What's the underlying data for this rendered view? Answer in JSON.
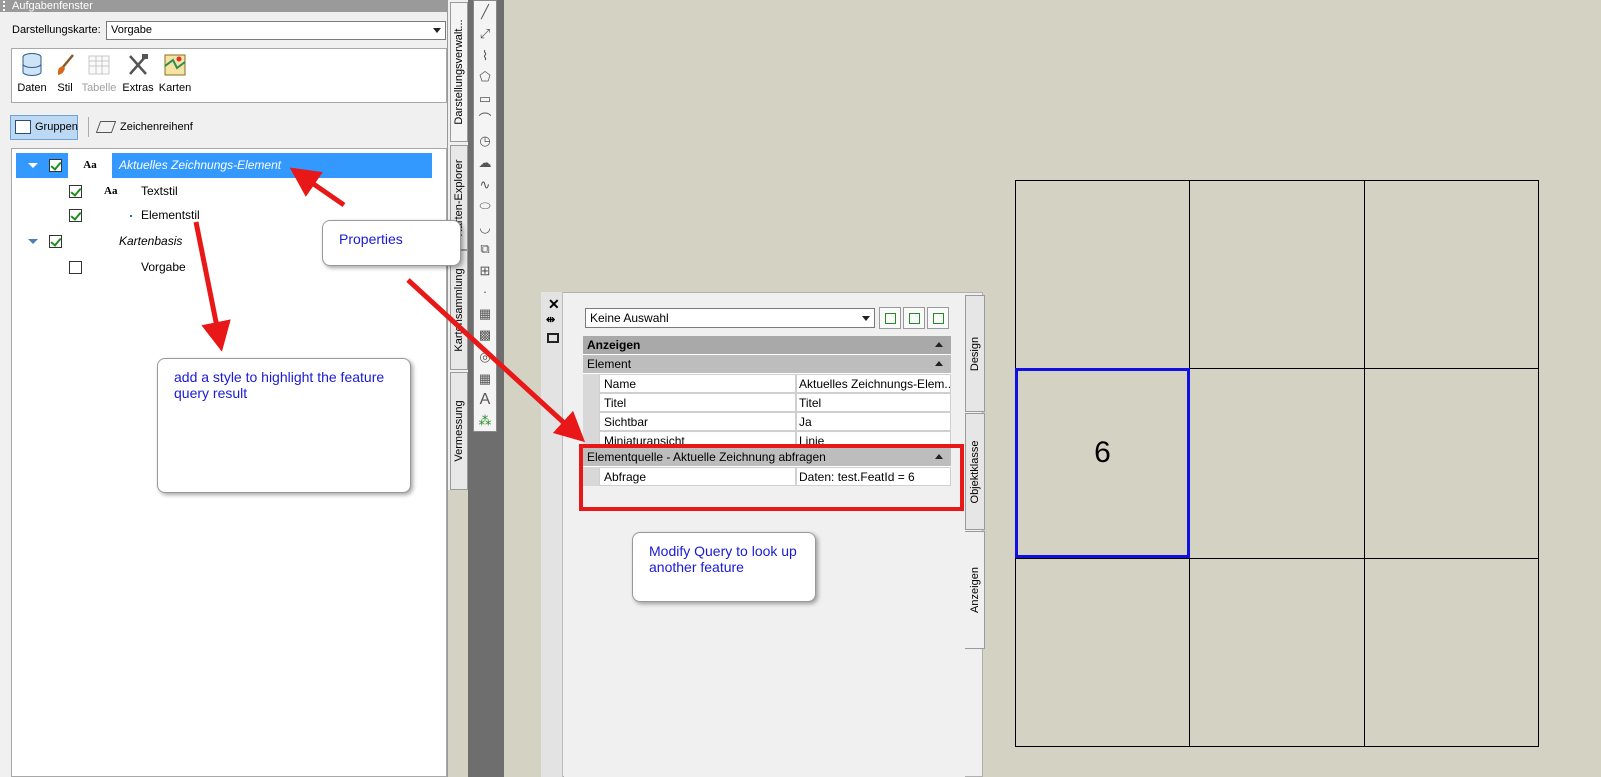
{
  "taskpane": {
    "title": "Aufgabenfenster",
    "map_label": "Darstellungskarte:",
    "map_value": "Vorgabe",
    "tools": [
      {
        "label": "Daten",
        "icon": "database-icon"
      },
      {
        "label": "Stil",
        "icon": "brush-icon"
      },
      {
        "label": "Tabelle",
        "icon": "table-icon"
      },
      {
        "label": "Extras",
        "icon": "tools-icon"
      },
      {
        "label": "Karten",
        "icon": "map-icon"
      }
    ],
    "view_tabs": {
      "groups": "Gruppen",
      "draw_order": "Zeichenreihenf"
    },
    "tree": [
      {
        "label": "Aktuelles Zeichnungs-Element",
        "aa": "Aa"
      },
      {
        "label": "Textstil",
        "aa": "Aa"
      },
      {
        "label": "Elementstil"
      },
      {
        "label": "Kartenbasis"
      },
      {
        "label": "Vorgabe"
      }
    ],
    "vertical_tabs": [
      "Darstellungsverwalt...",
      "Karten-Explorer",
      "Kartensammlung",
      "Vermessung"
    ]
  },
  "draw_toolbar": {
    "text_tool": "A"
  },
  "palette": {
    "selection_value": "Keine Auswahl",
    "categories": {
      "anzeigen": "Anzeigen",
      "element": "Element",
      "source": "Elementquelle - Aktuelle Zeichnung abfragen"
    },
    "properties": [
      {
        "key": "Name",
        "value": "Aktuelles Zeichnungs-Elem..."
      },
      {
        "key": "Titel",
        "value": "Titel"
      },
      {
        "key": "Sichtbar",
        "value": "Ja"
      },
      {
        "key": "Miniaturansicht",
        "value": "Linie"
      }
    ],
    "query": {
      "key": "Abfrage",
      "value": "Daten: test.FeatId = 6"
    },
    "side_tabs": [
      "Design",
      "Objektklasse",
      "Anzeigen"
    ]
  },
  "map": {
    "cell_label": "6"
  },
  "callouts": {
    "properties": "Properties",
    "style": "add a style to highlight the feature query result",
    "query": "Modify Query to look up another feature"
  },
  "colors": {
    "arrow": "#e81818",
    "selection": "#3399ff",
    "callout_text": "#1a1ad6",
    "highlight_cell": "#1010e0"
  }
}
